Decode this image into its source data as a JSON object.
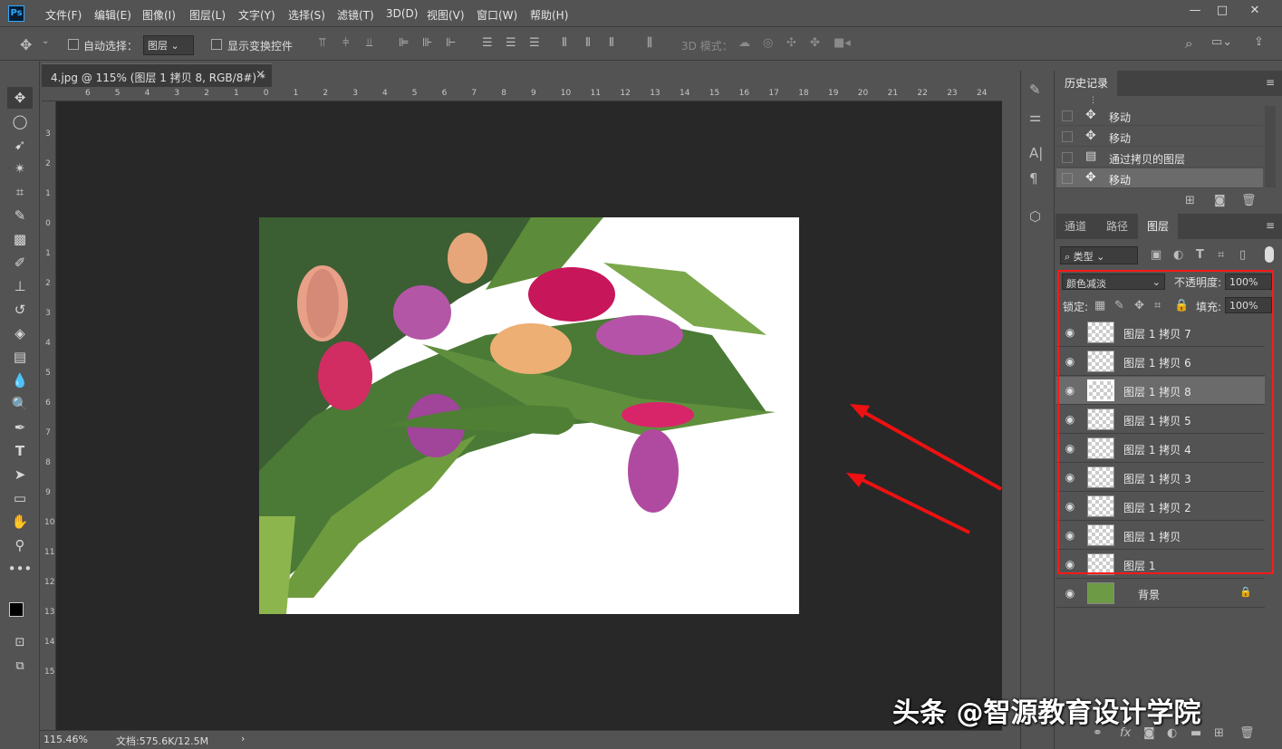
{
  "app": {
    "logo": "Ps"
  },
  "menu": [
    "文件(F)",
    "编辑(E)",
    "图像(I)",
    "图层(L)",
    "文字(Y)",
    "选择(S)",
    "滤镜(T)",
    "3D(D)",
    "视图(V)",
    "窗口(W)",
    "帮助(H)"
  ],
  "window_controls": {
    "minimize": "—",
    "maximize": "□",
    "close": "✕"
  },
  "options": {
    "auto_select_label": "自动选择：",
    "auto_select_value": "图层",
    "show_transform_label": "显示变换控件",
    "mode_3d_label": "3D 模式："
  },
  "document": {
    "tab_title": "4.jpg @ 115% (图层 1 拷贝 8, RGB/8#) *",
    "close": "×",
    "zoom": "115.46%",
    "doc_info": "文档:575.6K/12.5M",
    "ruler_top": [
      "6",
      "5",
      "4",
      "3",
      "2",
      "1",
      "0",
      "1",
      "2",
      "3",
      "4",
      "5",
      "6",
      "7",
      "8",
      "9",
      "10",
      "11",
      "12",
      "13",
      "14",
      "15",
      "16",
      "17",
      "18",
      "19",
      "20",
      "21",
      "22",
      "23",
      "24"
    ],
    "ruler_left": [
      "3",
      "2",
      "1",
      "0",
      "1",
      "2",
      "3",
      "4",
      "5",
      "6",
      "7",
      "8",
      "9",
      "10",
      "11",
      "12",
      "13",
      "14",
      "15"
    ]
  },
  "history": {
    "tab": "历史记录",
    "items": [
      {
        "icon": "move-icon",
        "label": "移动"
      },
      {
        "icon": "move-icon",
        "label": "移动"
      },
      {
        "icon": "layer-copy-icon",
        "label": "通过拷贝的图层"
      },
      {
        "icon": "move-icon",
        "label": "移动"
      }
    ]
  },
  "layers_panel": {
    "tabs": [
      "通道",
      "路径",
      "图层"
    ],
    "filter_label": "类型",
    "blend_mode": "颜色减淡",
    "opacity_label": "不透明度:",
    "opacity_value": "100%",
    "lock_label": "锁定:",
    "fill_label": "填充:",
    "fill_value": "100%",
    "layers": [
      {
        "name": "图层 1 拷贝 7",
        "selected": false
      },
      {
        "name": "图层 1 拷贝 6",
        "selected": false
      },
      {
        "name": "图层 1 拷贝 8",
        "selected": true
      },
      {
        "name": "图层 1 拷贝 5",
        "selected": false
      },
      {
        "name": "图层 1 拷贝 4",
        "selected": false
      },
      {
        "name": "图层 1 拷贝 3",
        "selected": false
      },
      {
        "name": "图层 1 拷贝 2",
        "selected": false
      },
      {
        "name": "图层 1 拷贝",
        "selected": false
      },
      {
        "name": "图层 1",
        "selected": false
      }
    ],
    "background_layer": "背景"
  },
  "watermark": "头条 @智源教育设计学院",
  "colors": {
    "ui_bg": "#535353",
    "canvas_bg": "#282828",
    "highlight": "#ff1a1a",
    "selected_layer": "#6b6b6b"
  }
}
